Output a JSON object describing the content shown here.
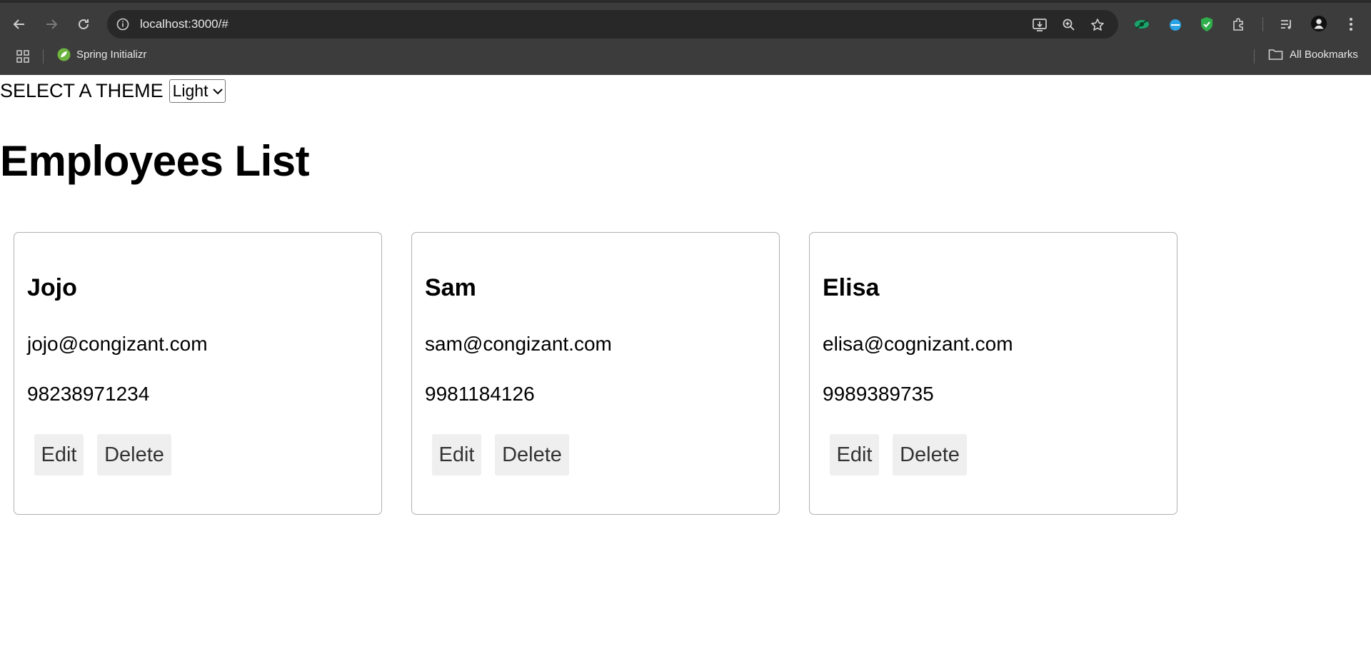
{
  "browser": {
    "url": "localhost:3000/#",
    "bookmarks": [
      {
        "label": "Spring Initializr"
      }
    ],
    "all_bookmarks_label": "All Bookmarks"
  },
  "theme": {
    "label": "SELECT A THEME",
    "selected": "Light"
  },
  "page": {
    "title": "Employees List"
  },
  "employees": [
    {
      "name": "Jojo",
      "email": "jojo@congizant.com",
      "phone": "98238971234"
    },
    {
      "name": "Sam",
      "email": "sam@congizant.com",
      "phone": "9981184126"
    },
    {
      "name": "Elisa",
      "email": "elisa@cognizant.com",
      "phone": "9989389735"
    }
  ],
  "card_actions": {
    "edit_label": "Edit",
    "delete_label": "Delete"
  }
}
